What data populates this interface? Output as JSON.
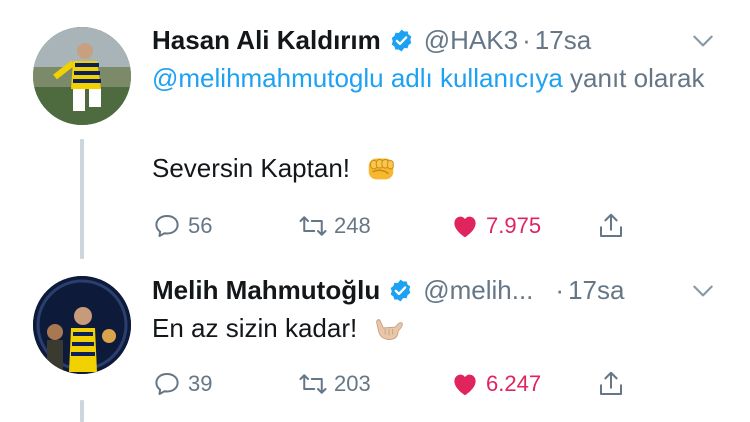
{
  "tweets": [
    {
      "name": "Hasan Ali Kaldırım",
      "handle": "@HAK3",
      "time": "17sa",
      "reply_to_mention": "@melihmahmutoglu adlı kullanıcıya",
      "reply_to_suffix": " yanıt olarak",
      "text": "Seversin Kaptan!",
      "emoji": "oncoming-fist-emoji",
      "replies": "56",
      "retweets": "248",
      "likes": "7.975",
      "liked": true
    },
    {
      "name": "Melih Mahmutoğlu",
      "handle": "@melih...",
      "time": "17sa",
      "text": "En az sizin kadar!",
      "emoji": "call-me-hand-emoji",
      "replies": "39",
      "retweets": "203",
      "likes": "6.247",
      "liked": true
    }
  ],
  "colors": {
    "verified": "#1da1f2",
    "mention": "#1da1f2",
    "like": "#e0245e",
    "secondary_text": "#657786",
    "thread_line": "#ccd6dd"
  }
}
